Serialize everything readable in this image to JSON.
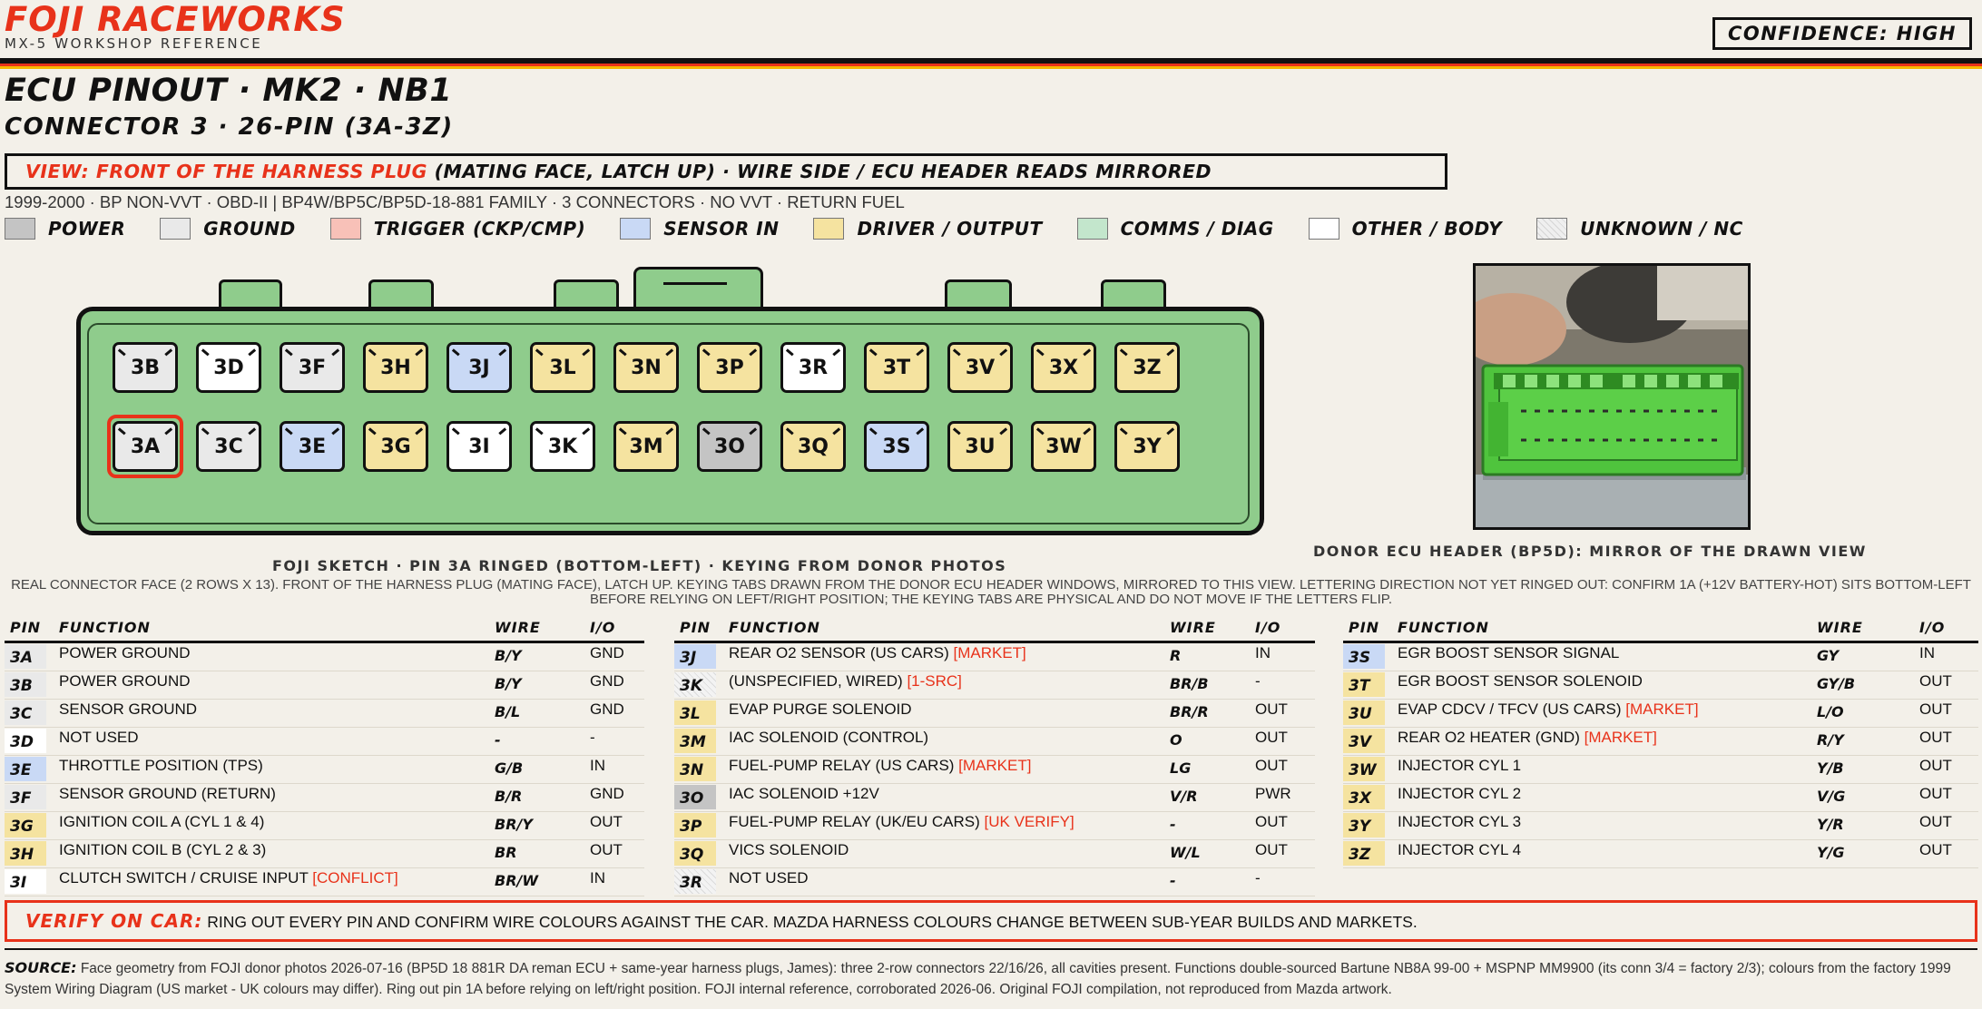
{
  "header": {
    "brand": "FOJI RACEWORKS",
    "subtitle": "MX-5 WORKSHOP REFERENCE",
    "confidence": "CONFIDENCE: HIGH"
  },
  "title": {
    "main": "ECU PINOUT · MK2 · NB1",
    "connector": "CONNECTOR 3 · 26-PIN (3A-3Z)"
  },
  "view": {
    "highlight": "VIEW: FRONT OF THE HARNESS PLUG",
    "rest": " (MATING FACE, LATCH UP) · WIRE SIDE / ECU HEADER READS MIRRORED"
  },
  "meta": "1999-2000 · BP NON-VVT · OBD-II  |  BP4W/BP5C/BP5D-18-881 FAMILY · 3 CONNECTORS · NO VVT · RETURN FUEL",
  "colors": {
    "power": "#c4c4c4",
    "ground": "#e9e9e9",
    "trigger": "#f8c1b8",
    "sensor": "#c9d9f5",
    "driver": "#f5e3a0",
    "comms": "#c3e6cc",
    "other": "#ffffff",
    "unknown": "#efefef",
    "accent": "#e8321a",
    "connector": "#8fcc8c"
  },
  "legend": [
    {
      "label": "POWER",
      "cat": "power"
    },
    {
      "label": "GROUND",
      "cat": "ground"
    },
    {
      "label": "TRIGGER (CKP/CMP)",
      "cat": "trigger"
    },
    {
      "label": "SENSOR IN",
      "cat": "sensor"
    },
    {
      "label": "DRIVER / OUTPUT",
      "cat": "driver"
    },
    {
      "label": "COMMS / DIAG",
      "cat": "comms"
    },
    {
      "label": "OTHER / BODY",
      "cat": "other"
    },
    {
      "label": "UNKNOWN / NC",
      "cat": "unknown"
    }
  ],
  "connector": {
    "top_row": [
      {
        "id": "3B",
        "cat": "ground"
      },
      {
        "id": "3D",
        "cat": "other"
      },
      {
        "id": "3F",
        "cat": "ground"
      },
      {
        "id": "3H",
        "cat": "driver"
      },
      {
        "id": "3J",
        "cat": "sensor"
      },
      {
        "id": "3L",
        "cat": "driver"
      },
      {
        "id": "3N",
        "cat": "driver"
      },
      {
        "id": "3P",
        "cat": "driver"
      },
      {
        "id": "3R",
        "cat": "other"
      },
      {
        "id": "3T",
        "cat": "driver"
      },
      {
        "id": "3V",
        "cat": "driver"
      },
      {
        "id": "3X",
        "cat": "driver"
      },
      {
        "id": "3Z",
        "cat": "driver"
      }
    ],
    "bottom_row": [
      {
        "id": "3A",
        "cat": "ground",
        "ringed": true
      },
      {
        "id": "3C",
        "cat": "ground"
      },
      {
        "id": "3E",
        "cat": "sensor"
      },
      {
        "id": "3G",
        "cat": "driver"
      },
      {
        "id": "3I",
        "cat": "other"
      },
      {
        "id": "3K",
        "cat": "other"
      },
      {
        "id": "3M",
        "cat": "driver"
      },
      {
        "id": "3O",
        "cat": "power"
      },
      {
        "id": "3Q",
        "cat": "driver"
      },
      {
        "id": "3S",
        "cat": "sensor"
      },
      {
        "id": "3U",
        "cat": "driver"
      },
      {
        "id": "3W",
        "cat": "driver"
      },
      {
        "id": "3Y",
        "cat": "driver"
      }
    ]
  },
  "captions": {
    "sketch": "FOJI SKETCH · PIN 3A RINGED (BOTTOM-LEFT) · KEYING FROM DONOR PHOTOS",
    "photo": "DONOR ECU HEADER (BP5D): MIRROR OF THE DRAWN VIEW",
    "note": "REAL CONNECTOR FACE (2 ROWS X 13). FRONT OF THE HARNESS PLUG (MATING FACE), LATCH UP. KEYING TABS DRAWN FROM THE DONOR ECU HEADER WINDOWS, MIRRORED TO THIS VIEW. LETTERING DIRECTION NOT YET RINGED OUT: CONFIRM 1A (+12V BATTERY-HOT) SITS BOTTOM-LEFT BEFORE RELYING ON LEFT/RIGHT POSITION; THE KEYING TABS ARE PHYSICAL AND DO NOT MOVE IF THE LETTERS FLIP."
  },
  "table_headers": {
    "pin": "PIN",
    "function": "FUNCTION",
    "wire": "WIRE",
    "io": "I/O"
  },
  "tables": [
    [
      {
        "pin": "3A",
        "cat": "ground",
        "fn": "POWER GROUND",
        "tag": "",
        "wire": "B/Y",
        "io": "GND"
      },
      {
        "pin": "3B",
        "cat": "ground",
        "fn": "POWER GROUND",
        "tag": "",
        "wire": "B/Y",
        "io": "GND"
      },
      {
        "pin": "3C",
        "cat": "ground",
        "fn": "SENSOR GROUND",
        "tag": "",
        "wire": "B/L",
        "io": "GND"
      },
      {
        "pin": "3D",
        "cat": "other",
        "fn": "NOT USED",
        "tag": "",
        "wire": "-",
        "io": "-"
      },
      {
        "pin": "3E",
        "cat": "sensor",
        "fn": "THROTTLE POSITION (TPS)",
        "tag": "",
        "wire": "G/B",
        "io": "IN"
      },
      {
        "pin": "3F",
        "cat": "ground",
        "fn": "SENSOR GROUND (RETURN)",
        "tag": "",
        "wire": "B/R",
        "io": "GND"
      },
      {
        "pin": "3G",
        "cat": "driver",
        "fn": "IGNITION COIL A (CYL 1 & 4)",
        "tag": "",
        "wire": "BR/Y",
        "io": "OUT"
      },
      {
        "pin": "3H",
        "cat": "driver",
        "fn": "IGNITION COIL B (CYL 2 & 3)",
        "tag": "",
        "wire": "BR",
        "io": "OUT"
      },
      {
        "pin": "3I",
        "cat": "other",
        "fn": "CLUTCH SWITCH / CRUISE INPUT ",
        "tag": "[CONFLICT]",
        "wire": "BR/W",
        "io": "IN"
      }
    ],
    [
      {
        "pin": "3J",
        "cat": "sensor",
        "fn": "REAR O2 SENSOR (US CARS) ",
        "tag": "[MARKET]",
        "wire": "R",
        "io": "IN"
      },
      {
        "pin": "3K",
        "cat": "unknown",
        "fn": "(UNSPECIFIED, WIRED) ",
        "tag": "[1-SRC]",
        "wire": "BR/B",
        "io": "-"
      },
      {
        "pin": "3L",
        "cat": "driver",
        "fn": "EVAP PURGE SOLENOID",
        "tag": "",
        "wire": "BR/R",
        "io": "OUT"
      },
      {
        "pin": "3M",
        "cat": "driver",
        "fn": "IAC SOLENOID (CONTROL)",
        "tag": "",
        "wire": "O",
        "io": "OUT"
      },
      {
        "pin": "3N",
        "cat": "driver",
        "fn": "FUEL-PUMP RELAY (US CARS) ",
        "tag": "[MARKET]",
        "wire": "LG",
        "io": "OUT"
      },
      {
        "pin": "3O",
        "cat": "power",
        "fn": "IAC SOLENOID +12V",
        "tag": "",
        "wire": "V/R",
        "io": "PWR"
      },
      {
        "pin": "3P",
        "cat": "driver",
        "fn": "FUEL-PUMP RELAY (UK/EU CARS) ",
        "tag": "[UK VERIFY]",
        "wire": "-",
        "io": "OUT"
      },
      {
        "pin": "3Q",
        "cat": "driver",
        "fn": "VICS SOLENOID",
        "tag": "",
        "wire": "W/L",
        "io": "OUT"
      },
      {
        "pin": "3R",
        "cat": "unknown",
        "fn": "NOT USED",
        "tag": "",
        "wire": "-",
        "io": "-"
      }
    ],
    [
      {
        "pin": "3S",
        "cat": "sensor",
        "fn": "EGR BOOST SENSOR SIGNAL",
        "tag": "",
        "wire": "GY",
        "io": "IN"
      },
      {
        "pin": "3T",
        "cat": "driver",
        "fn": "EGR BOOST SENSOR SOLENOID",
        "tag": "",
        "wire": "GY/B",
        "io": "OUT"
      },
      {
        "pin": "3U",
        "cat": "driver",
        "fn": "EVAP CDCV / TFCV (US CARS) ",
        "tag": "[MARKET]",
        "wire": "L/O",
        "io": "OUT"
      },
      {
        "pin": "3V",
        "cat": "driver",
        "fn": "REAR O2 HEATER (GND) ",
        "tag": "[MARKET]",
        "wire": "R/Y",
        "io": "OUT"
      },
      {
        "pin": "3W",
        "cat": "driver",
        "fn": "INJECTOR CYL 1",
        "tag": "",
        "wire": "Y/B",
        "io": "OUT"
      },
      {
        "pin": "3X",
        "cat": "driver",
        "fn": "INJECTOR CYL 2",
        "tag": "",
        "wire": "V/G",
        "io": "OUT"
      },
      {
        "pin": "3Y",
        "cat": "driver",
        "fn": "INJECTOR CYL 3",
        "tag": "",
        "wire": "Y/R",
        "io": "OUT"
      },
      {
        "pin": "3Z",
        "cat": "driver",
        "fn": "INJECTOR CYL 4",
        "tag": "",
        "wire": "Y/G",
        "io": "OUT"
      }
    ]
  ],
  "verify": {
    "label": "VERIFY ON CAR:",
    "text": " RING OUT EVERY PIN AND CONFIRM WIRE COLOURS AGAINST THE CAR. MAZDA HARNESS COLOURS CHANGE BETWEEN SUB-YEAR BUILDS AND MARKETS."
  },
  "source": {
    "label": "SOURCE:",
    "text": " Face geometry from FOJI donor photos 2026-07-16 (BP5D 18 881R DA reman ECU + same-year harness plugs, James): three 2-row connectors 22/16/26, all cavities present. Functions double-sourced Bartune NB8A 99-00 + MSPNP MM9900 (its conn 3/4 = factory 2/3); colours from the factory 1999 System Wiring Diagram (US market - UK colours may differ). Ring out pin 1A before relying on left/right position.   FOJI internal reference, corroborated 2026-06. Original FOJI compilation, not reproduced from Mazda artwork."
  }
}
